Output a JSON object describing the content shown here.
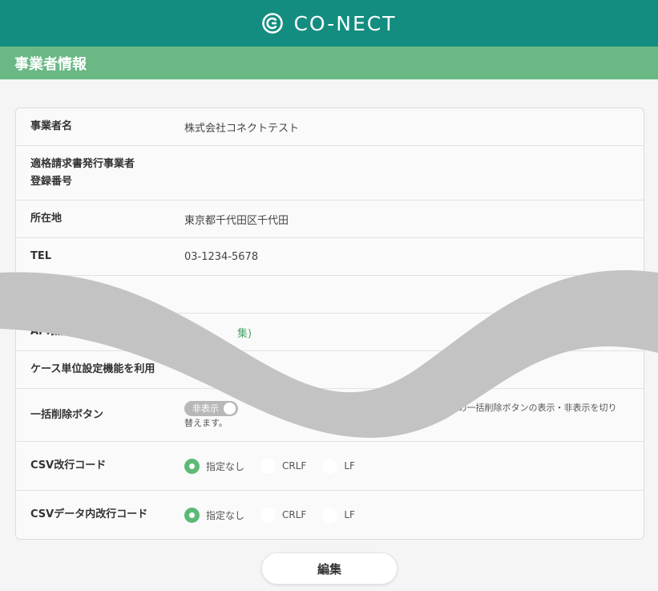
{
  "header": {
    "brand": "CO-NECT"
  },
  "section": {
    "title": "事業者情報"
  },
  "rows": {
    "company_name": {
      "label": "事業者名",
      "value": "株式会社コネクトテスト"
    },
    "invoice_number": {
      "label": "適格請求書発行事業者\n登録番号",
      "value": ""
    },
    "address": {
      "label": "所在地",
      "value": "東京都千代田区千代田"
    },
    "tel": {
      "label": "TEL",
      "value": "03-1234-5678"
    },
    "api": {
      "label": "API機能",
      "link": "集)"
    },
    "case_unit": {
      "label": "ケース単位設定機能を利用"
    },
    "bulk_delete": {
      "label": "一括削除ボタン",
      "toggle": "非表示",
      "desc_part1": "面画、商品一覧編集画面の一括削除ボタンの表示・非表示を切り",
      "desc_part2": "替えます。"
    },
    "csv_newline": {
      "label": "CSV改行コード",
      "options": [
        "指定なし",
        "CRLF",
        "LF"
      ],
      "selected": "指定なし"
    },
    "csv_data_newline": {
      "label": "CSVデータ内改行コード",
      "options": [
        "指定なし",
        "CRLF",
        "LF"
      ],
      "selected": "指定なし"
    }
  },
  "edit_button": {
    "label": "編集"
  },
  "colors": {
    "header": "#138d80",
    "section": "#6ab884",
    "accent": "#5cba77"
  }
}
